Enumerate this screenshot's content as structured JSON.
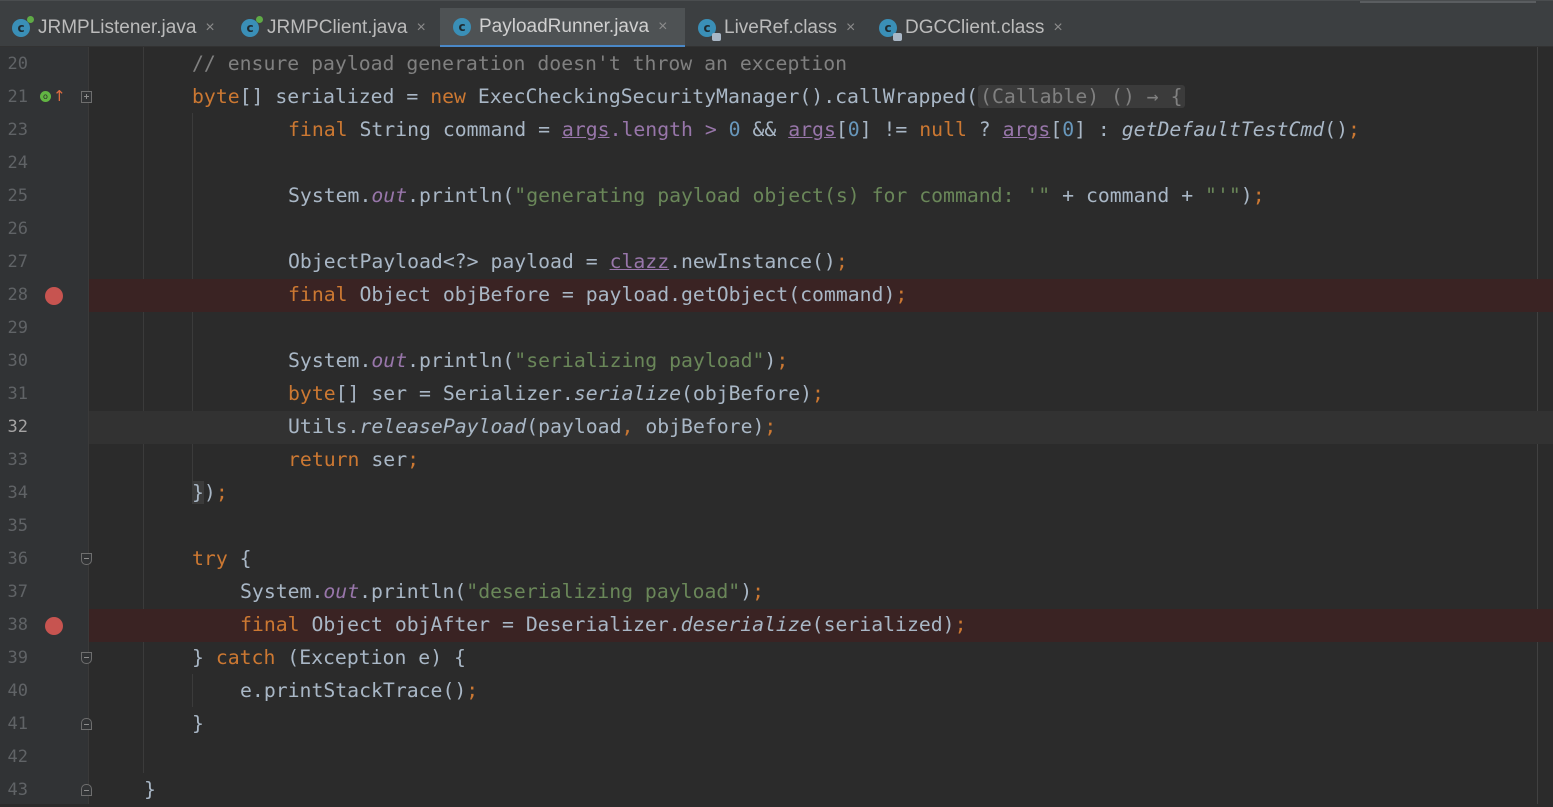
{
  "tabs": [
    {
      "label": "JRMPListener.java",
      "active": false,
      "icon": "class-icon"
    },
    {
      "label": "JRMPClient.java",
      "active": false,
      "icon": "class-icon"
    },
    {
      "label": "PayloadRunner.java",
      "active": true,
      "icon": "class-icon"
    },
    {
      "label": "LiveRef.class",
      "active": false,
      "icon": "compiled-class-icon"
    },
    {
      "label": "DGCClient.class",
      "active": false,
      "icon": "compiled-class-icon"
    }
  ],
  "close_glyph": "×",
  "colors": {
    "keyword": "#cc7832",
    "string": "#6a8759",
    "comment": "#808080",
    "number": "#6897bb",
    "field": "#9876aa",
    "breakpoint": "#c75450",
    "background": "#2b2b2b",
    "tab_accent": "#4a88c7"
  },
  "lines": [
    {
      "num": "20",
      "t": {
        "a": "// ensure payload generation doesn't throw an exception"
      }
    },
    {
      "num": "21",
      "t": {
        "a": "byte",
        "b": "[] serialized = ",
        "c": "new",
        "d": " ExecCheckingSecurityManager().callWrapped(",
        "e": "(Callable) () → {"
      }
    },
    {
      "num": "23",
      "t": {
        "a": "final",
        "b": " String command = ",
        "c": "args",
        "d": ".length > ",
        "e": "0",
        "f": " && ",
        "g": "args",
        "h": "[",
        "i": "0",
        "j": "] != ",
        "k": "null",
        "l": " ? ",
        "m": "args",
        "n": "[",
        "o": "0",
        "p": "] : ",
        "q": "getDefaultTestCmd",
        "r": "()",
        "s": ";"
      }
    },
    {
      "num": "24",
      "t": {}
    },
    {
      "num": "25",
      "t": {
        "a": "System.",
        "b": "out",
        "c": ".println(",
        "d": "\"generating payload object(s) for command: '\"",
        "e": " + command + ",
        "f": "\"'\"",
        "g": ")",
        "h": ";"
      }
    },
    {
      "num": "26",
      "t": {}
    },
    {
      "num": "27",
      "t": {
        "a": "ObjectPayload<?> payload = ",
        "b": "clazz",
        "c": ".newInstance()",
        "d": ";"
      }
    },
    {
      "num": "28",
      "t": {
        "a": "final",
        "b": " Object objBefore = payload.getObject(command)",
        "c": ";"
      }
    },
    {
      "num": "29",
      "t": {}
    },
    {
      "num": "30",
      "t": {
        "a": "System.",
        "b": "out",
        "c": ".println(",
        "d": "\"serializing payload\"",
        "e": ")",
        "f": ";"
      }
    },
    {
      "num": "31",
      "t": {
        "a": "byte",
        "b": "[] ser = Serializer.",
        "c": "serialize",
        "d": "(objBefore)",
        "e": ";"
      }
    },
    {
      "num": "32",
      "t": {
        "a": "Utils.",
        "b": "releasePayload",
        "c": "(payload",
        "d": ",",
        "e": " objBefore)",
        "f": ";"
      }
    },
    {
      "num": "33",
      "t": {
        "a": "return",
        "b": " ser",
        "c": ";"
      }
    },
    {
      "num": "34",
      "t": {
        "a": "}",
        "b": ")",
        "c": ";"
      }
    },
    {
      "num": "35",
      "t": {}
    },
    {
      "num": "36",
      "t": {
        "a": "try",
        "b": " {"
      }
    },
    {
      "num": "37",
      "t": {
        "a": "System.",
        "b": "out",
        "c": ".println(",
        "d": "\"deserializing payload\"",
        "e": ")",
        "f": ";"
      }
    },
    {
      "num": "38",
      "t": {
        "a": "final",
        "b": " Object objAfter = Deserializer.",
        "c": "deserialize",
        "d": "(serialized)",
        "e": ";"
      }
    },
    {
      "num": "39",
      "t": {
        "a": "} ",
        "b": "catch",
        "c": " (Exception e) {"
      }
    },
    {
      "num": "40",
      "t": {
        "a": "e.printStackTrace()",
        "b": ";"
      }
    },
    {
      "num": "41",
      "t": {
        "a": "}"
      }
    },
    {
      "num": "42",
      "t": {}
    },
    {
      "num": "43",
      "t": {
        "a": "}"
      }
    }
  ]
}
